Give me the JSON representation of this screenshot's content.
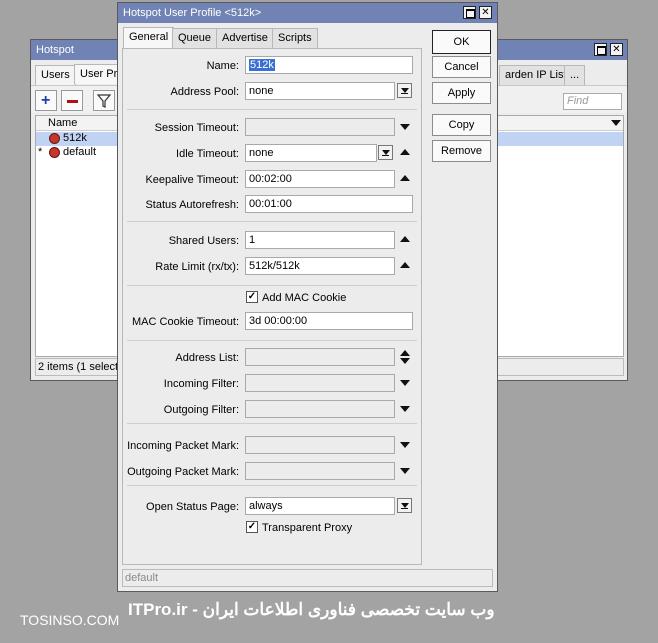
{
  "hotspot_window": {
    "title": "Hotspot",
    "tabs": [
      "Users",
      "User Pro",
      "arden IP List",
      "..."
    ],
    "find_placeholder": "Find",
    "column_name": "Name",
    "rows": [
      {
        "marker": "",
        "name": "512k"
      },
      {
        "marker": "*",
        "name": "default"
      }
    ],
    "status": "2 items (1 selecte"
  },
  "profile_dialog": {
    "title": "Hotspot User Profile <512k>",
    "tabs": [
      "General",
      "Queue",
      "Advertise",
      "Scripts"
    ],
    "buttons": [
      "OK",
      "Cancel",
      "Apply",
      "Copy",
      "Remove"
    ],
    "fields": {
      "name": {
        "label": "Name:",
        "value": "512k"
      },
      "address_pool": {
        "label": "Address Pool:",
        "value": "none"
      },
      "session_timeout": {
        "label": "Session Timeout:",
        "value": ""
      },
      "idle_timeout": {
        "label": "Idle Timeout:",
        "value": "none"
      },
      "keepalive_timeout": {
        "label": "Keepalive Timeout:",
        "value": "00:02:00"
      },
      "status_autorefresh": {
        "label": "Status Autorefresh:",
        "value": "00:01:00"
      },
      "shared_users": {
        "label": "Shared Users:",
        "value": "1"
      },
      "rate_limit": {
        "label": "Rate Limit (rx/tx):",
        "value": "512k/512k"
      },
      "add_mac_cookie": {
        "label": "Add MAC Cookie",
        "checked": true
      },
      "mac_cookie_timeout": {
        "label": "MAC Cookie Timeout:",
        "value": "3d 00:00:00"
      },
      "address_list": {
        "label": "Address List:",
        "value": ""
      },
      "incoming_filter": {
        "label": "Incoming Filter:",
        "value": ""
      },
      "outgoing_filter": {
        "label": "Outgoing Filter:",
        "value": ""
      },
      "incoming_packet_mark": {
        "label": "Incoming Packet Mark:",
        "value": ""
      },
      "outgoing_packet_mark": {
        "label": "Outgoing Packet Mark:",
        "value": ""
      },
      "open_status_page": {
        "label": "Open Status Page:",
        "value": "always"
      },
      "transparent_proxy": {
        "label": "Transparent Proxy",
        "checked": true
      }
    },
    "status": "default"
  },
  "watermark": {
    "left": "TOSINSO.COM",
    "right": "ITPro.ir - وب سایت تخصصی فناوری اطلاعات ایران"
  }
}
